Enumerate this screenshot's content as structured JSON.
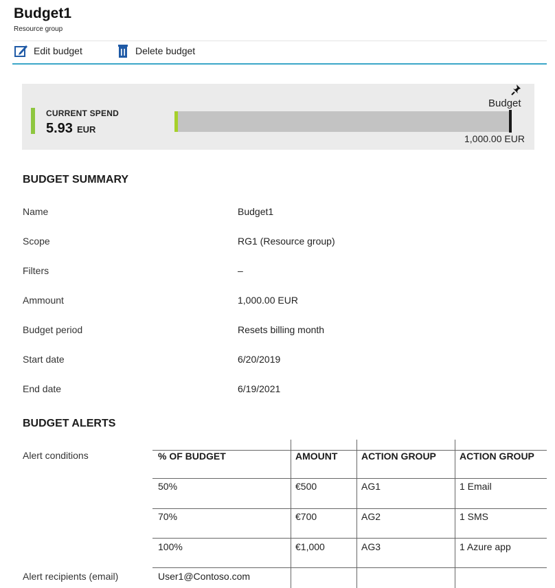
{
  "header": {
    "title": "Budget1",
    "subtitle": "Resource group"
  },
  "toolbar": {
    "edit_label": "Edit budget",
    "delete_label": "Delete budget",
    "edit_icon": "edit-icon",
    "delete_icon": "trash-icon"
  },
  "spend": {
    "label": "CURRENT SPEND",
    "value": "5.93",
    "currency": "EUR",
    "fill_fraction": 0.00593,
    "budget_label": "Budget",
    "budget_amount": "1,000.00 EUR",
    "pin_icon": "pin-icon"
  },
  "summary": {
    "heading": "BUDGET SUMMARY",
    "rows": [
      {
        "label": "Name",
        "value": "Budget1"
      },
      {
        "label": "Scope",
        "value": "RG1 (Resource group)"
      },
      {
        "label": "Filters",
        "value": "–"
      },
      {
        "label": "Ammount",
        "value": "1,000.00 EUR"
      },
      {
        "label": "Budget period",
        "value": "Resets billing month"
      },
      {
        "label": "Start date",
        "value": "6/20/2019"
      },
      {
        "label": "End date",
        "value": "6/19/2021"
      }
    ]
  },
  "alerts": {
    "heading": "BUDGET ALERTS",
    "conditions_label": "Alert conditions",
    "recipients_label": "Alert recipients (email)",
    "recipient": "User1@Contoso.com",
    "columns": [
      "% OF BUDGET",
      "AMOUNT",
      "ACTION GROUP",
      "ACTION GROUP"
    ],
    "rows": [
      [
        "50%",
        "€500",
        "AG1",
        "1 Email"
      ],
      [
        "70%",
        "€700",
        "AG2",
        "1 SMS"
      ],
      [
        "100%",
        "€1,000",
        "AG3",
        "1 Azure app"
      ]
    ]
  },
  "colors": {
    "accent_green": "#8ec63f",
    "bar_fill": "#a6d02b",
    "toolbar_line": "#3aa6c8",
    "icon_blue": "#1f5aa6"
  }
}
